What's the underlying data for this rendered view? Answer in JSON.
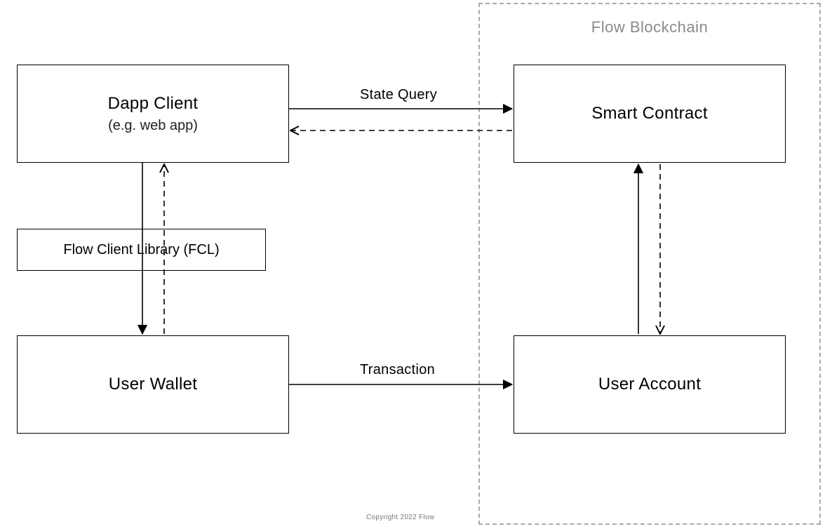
{
  "diagram": {
    "region": {
      "label": "Flow Blockchain"
    },
    "nodes": {
      "dapp_client": {
        "title": "Dapp Client",
        "subtitle": "(e.g. web app)"
      },
      "fcl": {
        "title": "Flow Client Library (FCL)"
      },
      "user_wallet": {
        "title": "User Wallet"
      },
      "smart_contract": {
        "title": "Smart Contract"
      },
      "user_account": {
        "title": "User Account"
      }
    },
    "edges": {
      "state_query": "State Query",
      "transaction": "Transaction"
    },
    "copyright": "Copyright 2022 Flow"
  }
}
